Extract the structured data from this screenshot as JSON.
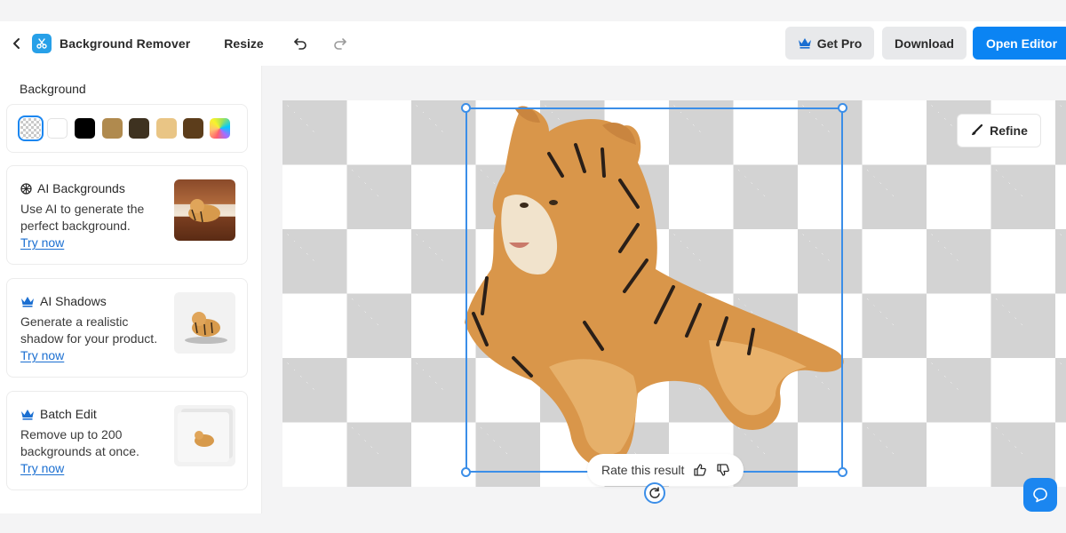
{
  "header": {
    "title": "Background Remover",
    "resize_label": "Resize",
    "get_pro_label": "Get Pro",
    "download_label": "Download",
    "open_editor_label": "Open Editor"
  },
  "sidebar": {
    "heading": "Background",
    "swatches": [
      "transparent",
      "#ffffff",
      "#000000",
      "#b08a4e",
      "#3e3220",
      "#e9c585",
      "#5c3d1b",
      "gradient"
    ],
    "cards": [
      {
        "title": "AI Backgrounds",
        "icon": "sparkle-icon",
        "description": "Use AI to generate the perfect background.",
        "link": "Try now"
      },
      {
        "title": "AI Shadows",
        "icon": "crown-icon",
        "description": "Generate a realistic shadow for your product.",
        "link": "Try now"
      },
      {
        "title": "Batch Edit",
        "icon": "crown-icon",
        "description": "Remove up to 200 backgrounds at once.",
        "link": "Try now"
      }
    ]
  },
  "canvas": {
    "refine_label": "Refine",
    "rate_label": "Rate this result"
  },
  "colors": {
    "accent": "#0b84f3",
    "selection": "#3b8ee8",
    "link": "#1b6fd1"
  }
}
